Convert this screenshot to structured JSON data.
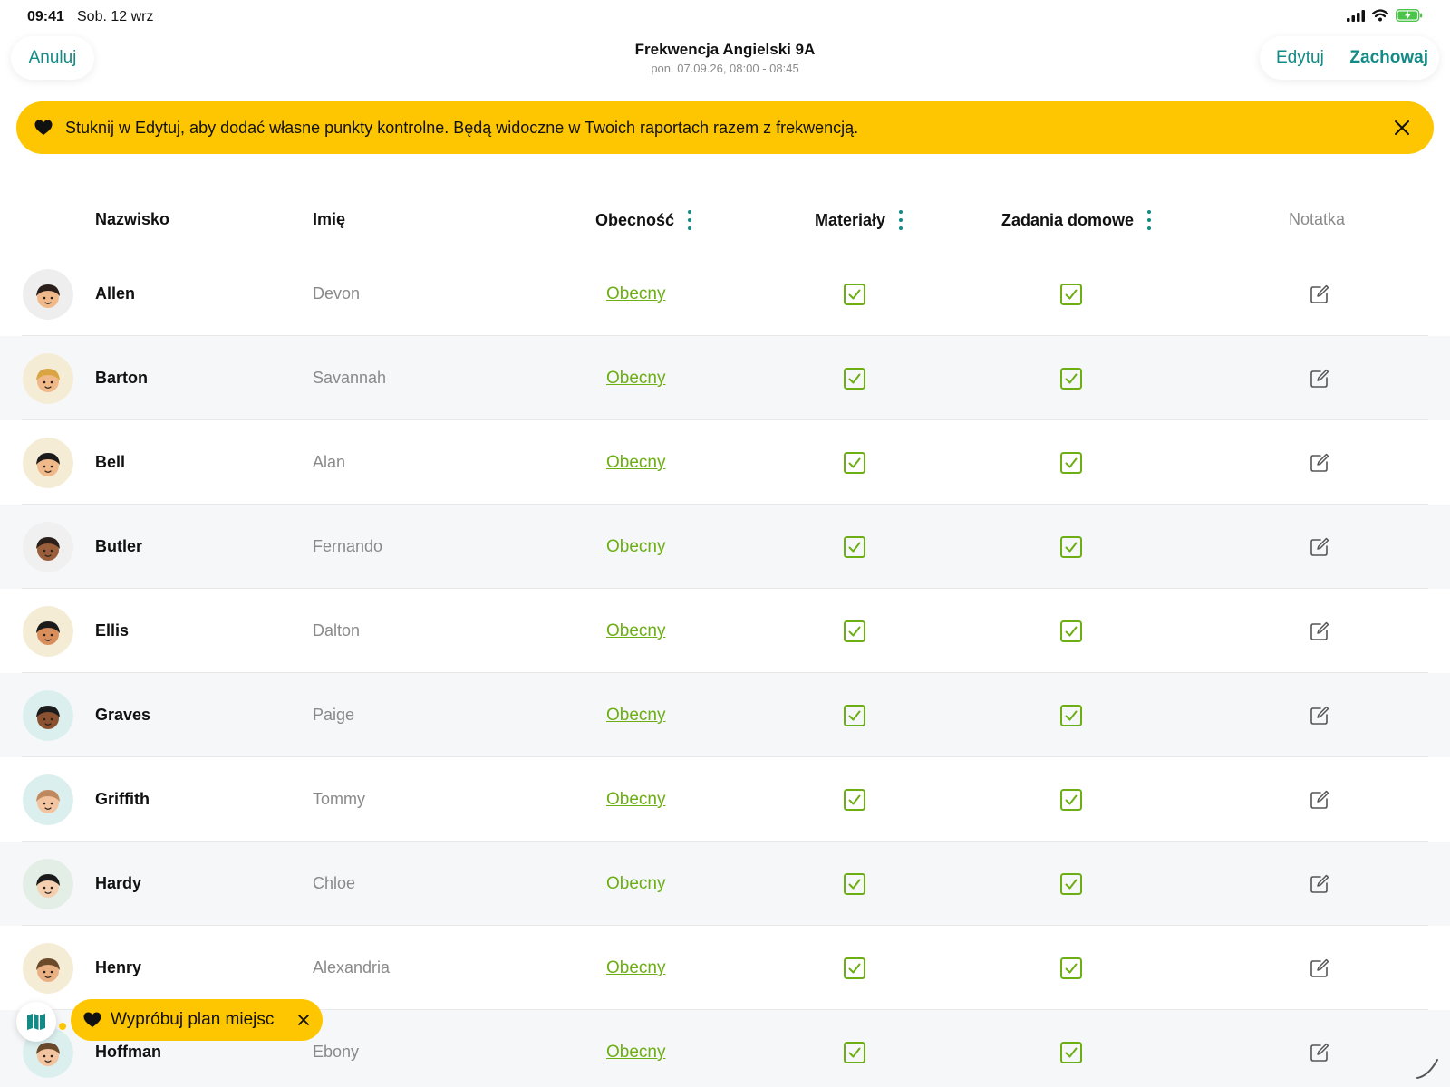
{
  "status_bar": {
    "time": "09:41",
    "date": "Sob. 12 wrz"
  },
  "nav": {
    "cancel_label": "Anuluj",
    "title": "Frekwencja Angielski 9A",
    "subtitle": "pon. 07.09.26, 08:00 - 08:45",
    "edit_label": "Edytuj",
    "save_label": "Zachowaj"
  },
  "banner": {
    "text": "Stuknij w Edytuj, aby dodać własne punkty kontrolne. Będą widoczne w Twoich raportach razem z frekwencją."
  },
  "columns": {
    "surname": "Nazwisko",
    "firstname": "Imię",
    "presence": "Obecność",
    "materials": "Materiały",
    "homework": "Zadania domowe",
    "note": "Notatka"
  },
  "students": [
    {
      "surname": "Allen",
      "firstname": "Devon",
      "presence": "Obecny",
      "materials": true,
      "homework": true,
      "avatar": "avatar-face-dark-hair-bob"
    },
    {
      "surname": "Barton",
      "firstname": "Savannah",
      "presence": "Obecny",
      "materials": true,
      "homework": true,
      "avatar": "avatar-face-blonde-hair"
    },
    {
      "surname": "Bell",
      "firstname": "Alan",
      "presence": "Obecny",
      "materials": true,
      "homework": true,
      "avatar": "avatar-face-dark-hair"
    },
    {
      "surname": "Butler",
      "firstname": "Fernando",
      "presence": "Obecny",
      "materials": true,
      "homework": true,
      "avatar": "avatar-face-bun"
    },
    {
      "surname": "Ellis",
      "firstname": "Dalton",
      "presence": "Obecny",
      "materials": true,
      "homework": true,
      "avatar": "avatar-face-long-hair"
    },
    {
      "surname": "Graves",
      "firstname": "Paige",
      "presence": "Obecny",
      "materials": true,
      "homework": true,
      "avatar": "avatar-face-dark-skin"
    },
    {
      "surname": "Griffith",
      "firstname": "Tommy",
      "presence": "Obecny",
      "materials": true,
      "homework": true,
      "avatar": "avatar-face-light-hair"
    },
    {
      "surname": "Hardy",
      "firstname": "Chloe",
      "presence": "Obecny",
      "materials": true,
      "homework": true,
      "avatar": "avatar-face-side-part"
    },
    {
      "surname": "Henry",
      "firstname": "Alexandria",
      "presence": "Obecny",
      "materials": true,
      "homework": true,
      "avatar": "avatar-face-topknot"
    },
    {
      "surname": "Hoffman",
      "firstname": "Ebony",
      "presence": "Obecny",
      "materials": true,
      "homework": true,
      "avatar": "avatar-face-light"
    }
  ],
  "seating_toast": {
    "text": "Wypróbuj plan miejsc"
  },
  "colors": {
    "accent": "#138a85",
    "banner": "#fec600",
    "present": "#6cae13",
    "muted": "#8a8a8a"
  }
}
